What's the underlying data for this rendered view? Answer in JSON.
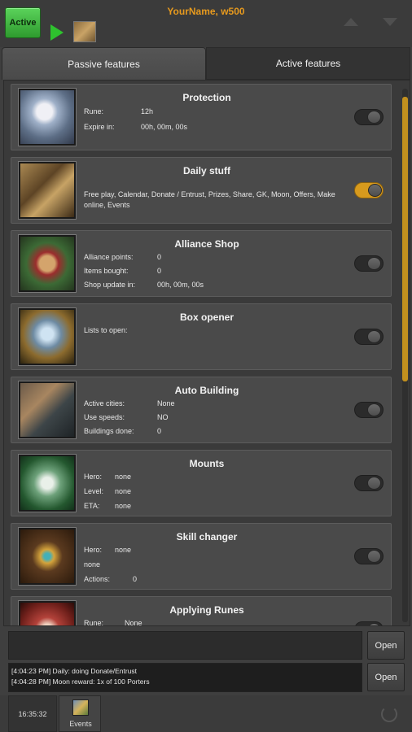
{
  "header": {
    "active_label": "Active",
    "username": "YourName, w500"
  },
  "tabs": [
    {
      "label": "Passive features"
    },
    {
      "label": "Active features"
    }
  ],
  "features": [
    {
      "title": "Protection",
      "toggle_on": false,
      "rows": [
        {
          "label": "Rune:",
          "value": "12h"
        },
        {
          "label": "Expire in:",
          "value": "00h, 00m, 00s"
        }
      ]
    },
    {
      "title": "Daily stuff",
      "toggle_on": true,
      "description": "Free play, Calendar, Donate / Entrust, Prizes, Share, GK, Moon, Offers, Make online, Events"
    },
    {
      "title": "Alliance Shop",
      "toggle_on": false,
      "rows": [
        {
          "label": "Alliance points:",
          "value": "0"
        },
        {
          "label": "Items bought:",
          "value": "0"
        },
        {
          "label": "Shop update in:",
          "value": "00h, 00m, 00s"
        }
      ]
    },
    {
      "title": "Box opener",
      "toggle_on": false,
      "rows": [
        {
          "label": "Lists to open:",
          "value": ""
        }
      ]
    },
    {
      "title": "Auto Building",
      "toggle_on": false,
      "rows": [
        {
          "label": "Active cities:",
          "value": "None"
        },
        {
          "label": "Use speeds:",
          "value": "NO"
        },
        {
          "label": "Buildings done:",
          "value": "0"
        }
      ]
    },
    {
      "title": "Mounts",
      "toggle_on": false,
      "rows": [
        {
          "label": "Hero:",
          "value": "none"
        },
        {
          "label": "Level:",
          "value": "none"
        },
        {
          "label": "ETA:",
          "value": "none"
        }
      ]
    },
    {
      "title": "Skill changer",
      "toggle_on": false,
      "rows": [
        {
          "label": "Hero:",
          "value": "none"
        },
        {
          "label": "none",
          "value": ""
        },
        {
          "label": "Actions:",
          "value": "0"
        }
      ]
    },
    {
      "title": "Applying Runes",
      "toggle_on": false,
      "rows": [
        {
          "label": "Rune:",
          "value": "None"
        }
      ]
    }
  ],
  "log": {
    "lines": [
      "[4:04:23 PM] Daily: doing Donate/Entrust",
      "[4:04:28 PM] Moon reward: 1x of 100 Porters"
    ],
    "open_label_1": "Open",
    "open_label_2": "Open"
  },
  "footer": {
    "clock": "16:35:32",
    "events_label": "Events"
  },
  "colors": {
    "accent": "#d79a1d",
    "active_green": "#3fbf3f",
    "username": "#e79a1e"
  }
}
